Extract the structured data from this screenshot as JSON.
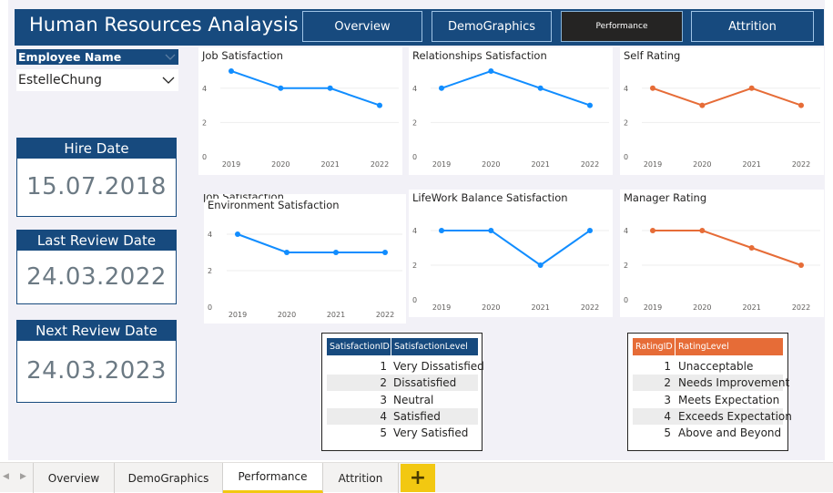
{
  "header": {
    "title": "Human Resources Analaysis",
    "nav": [
      {
        "label": "Overview",
        "active": false
      },
      {
        "label": "DemoGraphics",
        "active": false
      },
      {
        "label": "Performance",
        "active": true
      },
      {
        "label": "Attrition",
        "active": false
      }
    ]
  },
  "slicer": {
    "header": "Employee Name",
    "value": "EstelleChung"
  },
  "cards": [
    {
      "title": "Hire Date",
      "value": "15.07.2018"
    },
    {
      "title": "Last Review Date",
      "value": "24.03.2022"
    },
    {
      "title": "Next Review Date",
      "value": "24.03.2023"
    }
  ],
  "chart_data": [
    {
      "type": "line",
      "title": "Job Satisfaction",
      "x": [
        "2019",
        "2020",
        "2021",
        "2022"
      ],
      "values": [
        5,
        4,
        4,
        3
      ],
      "ylim": [
        0,
        5
      ],
      "yticks": [
        "0",
        "2",
        "4"
      ],
      "color": "#118dff"
    },
    {
      "type": "line",
      "title": "Relationships Satisfaction",
      "x": [
        "2019",
        "2020",
        "2021",
        "2022"
      ],
      "values": [
        4,
        5,
        4,
        3
      ],
      "ylim": [
        0,
        5
      ],
      "yticks": [
        "0",
        "2",
        "4"
      ],
      "color": "#118dff"
    },
    {
      "type": "line",
      "title": "Self Rating",
      "x": [
        "2019",
        "2020",
        "2021",
        "2022"
      ],
      "values": [
        4,
        3,
        4,
        3
      ],
      "ylim": [
        0,
        5
      ],
      "yticks": [
        "0",
        "2",
        "4"
      ],
      "color": "#e66c37"
    },
    {
      "type": "line",
      "title": "Environment Satisfaction",
      "title_behind": "Job Satisfaction",
      "x": [
        "2019",
        "2020",
        "2021",
        "2022"
      ],
      "values": [
        4,
        3,
        3,
        3
      ],
      "ylim": [
        0,
        5
      ],
      "yticks": [
        "0",
        "2",
        "4"
      ],
      "color": "#118dff"
    },
    {
      "type": "line",
      "title": "LifeWork Balance Satisfaction",
      "x": [
        "2019",
        "2020",
        "2021",
        "2022"
      ],
      "values": [
        4,
        4,
        2,
        4
      ],
      "ylim": [
        0,
        5
      ],
      "yticks": [
        "0",
        "2",
        "4"
      ],
      "color": "#118dff"
    },
    {
      "type": "line",
      "title": "Manager Rating",
      "x": [
        "2019",
        "2020",
        "2021",
        "2022"
      ],
      "values": [
        4,
        4,
        3,
        2
      ],
      "ylim": [
        0,
        5
      ],
      "yticks": [
        "0",
        "2",
        "4"
      ],
      "color": "#e66c37"
    }
  ],
  "satisfaction_table": {
    "headers": [
      "SatisfactionID",
      "SatisfactionLevel"
    ],
    "header_color": "#174a7e",
    "rows": [
      {
        "id": "1",
        "level": "Very Dissatisfied"
      },
      {
        "id": "2",
        "level": "Dissatisfied"
      },
      {
        "id": "3",
        "level": "Neutral"
      },
      {
        "id": "4",
        "level": "Satisfied"
      },
      {
        "id": "5",
        "level": "Very Satisfied"
      }
    ]
  },
  "rating_table": {
    "headers": [
      "RatingID",
      "RatingLevel"
    ],
    "header_color": "#e66c37",
    "rows": [
      {
        "id": "1",
        "level": "Unacceptable"
      },
      {
        "id": "2",
        "level": "Needs Improvement"
      },
      {
        "id": "3",
        "level": "Meets Expectation"
      },
      {
        "id": "4",
        "level": "Exceeds Expectation"
      },
      {
        "id": "5",
        "level": "Above and Beyond"
      }
    ]
  },
  "tabs": [
    {
      "label": "Overview",
      "active": false
    },
    {
      "label": "DemoGraphics",
      "active": false
    },
    {
      "label": "Performance",
      "active": true
    },
    {
      "label": "Attrition",
      "active": false
    }
  ],
  "add_tab_label": "+",
  "icons": {
    "prev": "chevron-left-icon",
    "next": "chevron-right-icon",
    "dropdown": "chevron-down-icon"
  }
}
